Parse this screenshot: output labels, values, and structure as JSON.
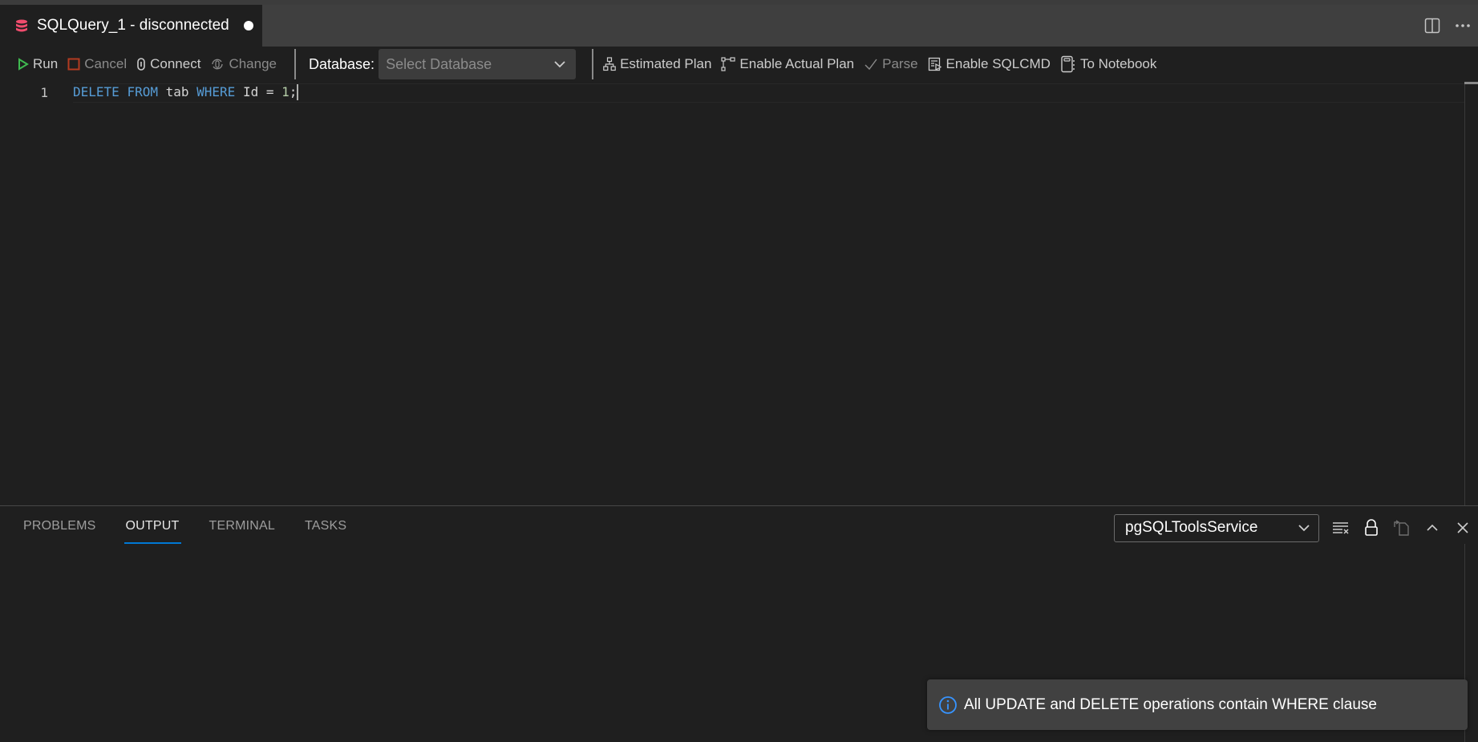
{
  "tab": {
    "title": "SQLQuery_1 - disconnected",
    "icon": "database-icon",
    "dirty": true,
    "icon_color": "#f14c6d"
  },
  "tab_actions": [
    {
      "name": "split-editor-icon",
      "label": "Split Editor"
    },
    {
      "name": "more-actions-icon",
      "label": "More Actions"
    }
  ],
  "toolbar": {
    "run": "Run",
    "cancel": "Cancel",
    "connect": "Connect",
    "change": "Change",
    "database_label": "Database:",
    "database_placeholder": "Select Database",
    "estimated_plan": "Estimated Plan",
    "enable_actual_plan": "Enable Actual Plan",
    "parse": "Parse",
    "enable_sqlcmd": "Enable SQLCMD",
    "to_notebook": "To Notebook",
    "run_color": "#3fb950",
    "cancel_color": "#b33b20"
  },
  "editor": {
    "lines": [
      {
        "number": "1",
        "tokens": [
          {
            "t": "DELETE",
            "c": "kw"
          },
          {
            "t": " ",
            "c": "op"
          },
          {
            "t": "FROM",
            "c": "kw"
          },
          {
            "t": " tab ",
            "c": "id"
          },
          {
            "t": "WHERE",
            "c": "kw"
          },
          {
            "t": " Id = ",
            "c": "id"
          },
          {
            "t": "1",
            "c": "num"
          },
          {
            "t": ";",
            "c": "op"
          }
        ]
      }
    ]
  },
  "panel": {
    "tabs": [
      {
        "label": "PROBLEMS",
        "active": false
      },
      {
        "label": "OUTPUT",
        "active": true
      },
      {
        "label": "TERMINAL",
        "active": false
      },
      {
        "label": "TASKS",
        "active": false
      }
    ],
    "output_channel": "pgSQLToolsService",
    "actions": [
      {
        "name": "clear-output-icon"
      },
      {
        "name": "lock-scroll-icon"
      },
      {
        "name": "open-output-editor-icon"
      },
      {
        "name": "maximize-panel-icon"
      },
      {
        "name": "close-panel-icon"
      }
    ]
  },
  "notification": {
    "icon": "info-icon",
    "message": "All UPDATE and DELETE operations contain WHERE clause",
    "icon_color": "#3794ff"
  }
}
